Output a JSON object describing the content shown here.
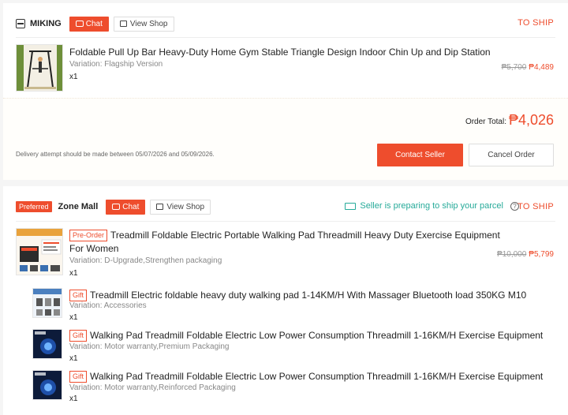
{
  "order1": {
    "shop_name": "MIKING",
    "chat_label": "Chat",
    "view_shop_label": "View Shop",
    "status_label": "TO SHIP",
    "item": {
      "title": "Foldable Pull Up Bar Heavy-Duty Home Gym Stable Triangle Design Indoor Chin Up and Dip Station",
      "variation": "Variation: Flagship Version",
      "qty": "x1",
      "old_price": "₱5,700",
      "price": "₱4,489"
    },
    "total_label": "Order Total:",
    "total_value": "₱4,026",
    "delivery_note": "Delivery attempt should be made between 05/07/2026 and 05/09/2026.",
    "contact_label": "Contact Seller",
    "cancel_label": "Cancel Order"
  },
  "order2": {
    "badge": "Preferred",
    "shop_name": "Zone Mall",
    "chat_label": "Chat",
    "view_shop_label": "View Shop",
    "shipping_status": "Seller is preparing to ship your parcel",
    "help_icon_glyph": "?",
    "status_label": "TO SHIP",
    "main_item": {
      "tag": "Pre-Order",
      "title_line1": "Treadmill Foldable Electric Portable Walking Pad Threadmill Heavy Duty Exercise Equipment",
      "title_line2": "For Women",
      "variation": "Variation: D-Upgrade,Strengthen packaging",
      "qty": "x1",
      "old_price": "₱10,000",
      "price": "₱5,799"
    },
    "gifts": [
      {
        "tag": "Gift",
        "title": "Treadmill Electric foldable heavy duty walking pad 1-14KM/H With Massager Bluetooth load 350KG M10",
        "variation": "Variation: Accessories",
        "qty": "x1"
      },
      {
        "tag": "Gift",
        "title": "Walking Pad Treadmill Foldable Electric Low Power Consumption Threadmill 1-16KM/H Exercise Equipment",
        "variation": "Variation: Motor warranty,Premium Packaging",
        "qty": "x1"
      },
      {
        "tag": "Gift",
        "title": "Walking Pad Treadmill Foldable Electric Low Power Consumption Threadmill 1-16KM/H Exercise Equipment",
        "variation": "Variation: Motor warranty,Reinforced Packaging",
        "qty": "x1"
      }
    ]
  },
  "colors": {
    "accent": "#ee4d2d",
    "teal": "#26aa99"
  }
}
